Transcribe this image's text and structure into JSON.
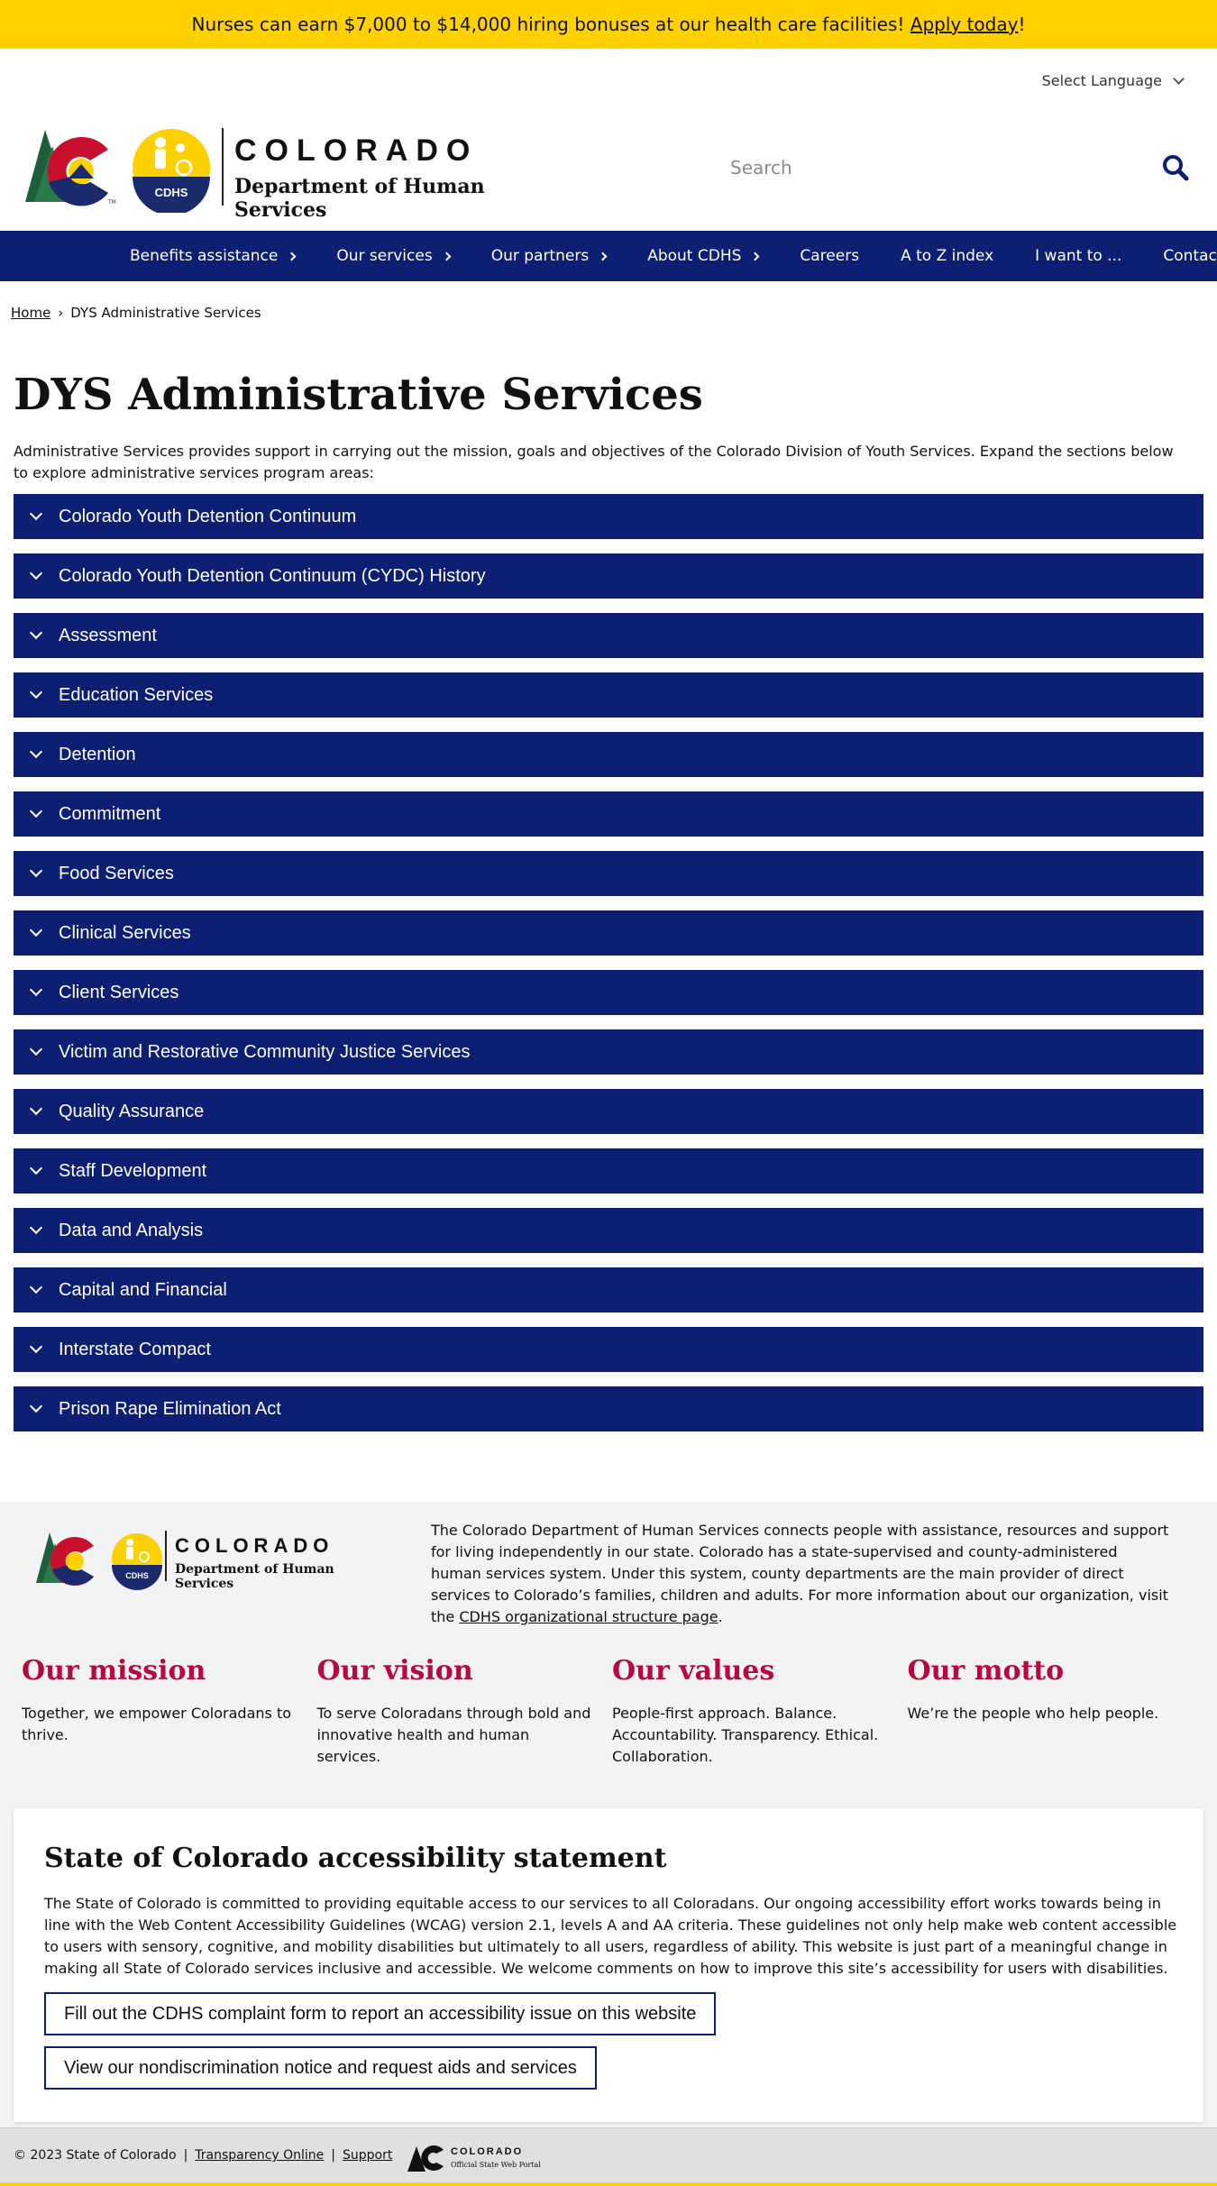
{
  "promo": {
    "text": "Nurses can earn $7,000 to $14,000 hiring bonuses at our health care facilities! ",
    "link": "Apply today",
    "suffix": "!"
  },
  "language": {
    "label": "Select Language"
  },
  "logo": {
    "wordmark": "COLORADO",
    "department": "Department of Human Services",
    "badge": "CDHS"
  },
  "search": {
    "placeholder": "Search"
  },
  "nav": {
    "items": [
      {
        "label": "Benefits assistance",
        "has_submenu": true
      },
      {
        "label": "Our services",
        "has_submenu": true
      },
      {
        "label": "Our partners",
        "has_submenu": true
      },
      {
        "label": "About CDHS",
        "has_submenu": true
      },
      {
        "label": "Careers",
        "has_submenu": false
      },
      {
        "label": "A to Z index",
        "has_submenu": false
      },
      {
        "label": "I want to ...",
        "has_submenu": false
      },
      {
        "label": "Contact us",
        "has_submenu": false
      }
    ]
  },
  "breadcrumb": {
    "home": "Home",
    "separator": "›",
    "current": "DYS Administrative Services"
  },
  "page": {
    "title": "DYS Administrative Services",
    "intro": "Administrative Services provides support in carrying out the mission, goals and objectives of the Colorado Division of Youth Services. Expand the sections below to explore administrative services program areas:"
  },
  "accordion": [
    "Colorado Youth Detention Continuum",
    "Colorado Youth Detention Continuum (CYDC) History",
    "Assessment",
    "Education Services",
    "Detention",
    "Commitment",
    "Food Services",
    "Clinical Services",
    "Client Services",
    "Victim and Restorative Community Justice Services",
    "Quality Assurance",
    "Staff Development",
    "Data and Analysis",
    "Capital and Financial",
    "Interstate Compact",
    "Prison Rape Elimination Act"
  ],
  "footer": {
    "description": "The Colorado Department of Human Services connects people with assistance, resources and support for living independently in our state. Colorado has a state-supervised and county-administered human services system. Under this system, county departments are the main provider of direct services to Colorado’s families, children and adults. For more information about our organization, visit the ",
    "description_link": "CDHS organizational structure page",
    "description_end": ".",
    "values": [
      {
        "heading": "Our mission",
        "text": "Together, we empower Coloradans to thrive."
      },
      {
        "heading": "Our vision",
        "text": "To serve Coloradans through bold and innovative health and human services."
      },
      {
        "heading": "Our values",
        "text": "People-first approach. Balance. Accountability. Transparency. Ethical. Collaboration."
      },
      {
        "heading": "Our motto",
        "text": "We’re the people who help people."
      }
    ],
    "accessibility": {
      "heading": "State of Colorado accessibility statement",
      "text": "The State of Colorado is committed to providing equitable access to our services to all Coloradans. Our ongoing accessibility effort works towards being in line with the Web Content Accessibility Guidelines (WCAG) version 2.1, levels A and AA criteria. These guidelines not only help make web content accessible to users with sensory, cognitive, and mobility disabilities but ultimately to all users, regardless of ability. This website is just part of a meaningful change in making all State of Colorado services inclusive and accessible. We welcome comments on how to improve this site’s accessibility for users with disabilities.",
      "button1": "Fill out the CDHS complaint form to report an accessibility issue on this website",
      "button2": "View our nondiscrimination notice and request aids and services"
    }
  },
  "bottom": {
    "copyright": "© 2023 State of Colorado",
    "sep": "|",
    "link1": "Transparency Online",
    "link2": "Support",
    "portal_name": "COLORADO",
    "portal_sub": "Official State Web Portal"
  },
  "colors": {
    "nav_blue": "#0c1f73",
    "promo_yellow": "#ffd100",
    "heading_red": "#b8093f"
  }
}
